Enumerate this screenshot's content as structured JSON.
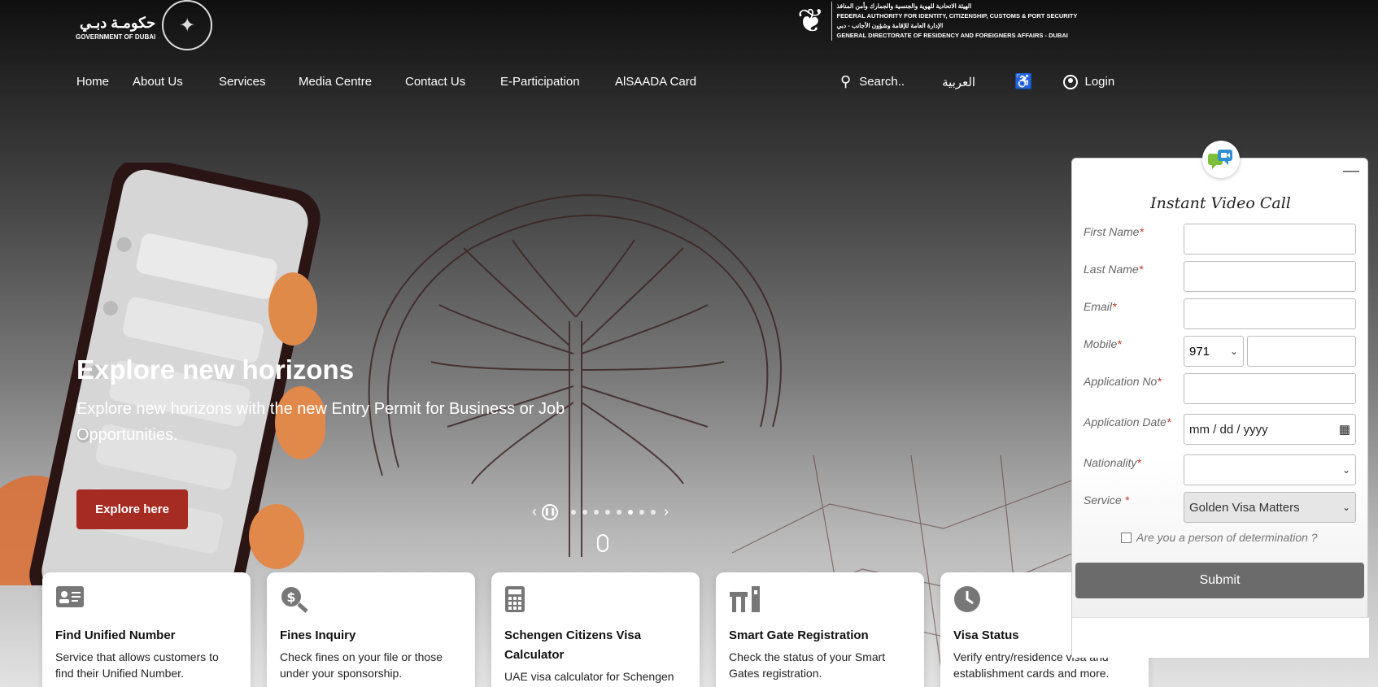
{
  "header": {
    "gov_logo_ar": "حكومـة دبـي",
    "gov_logo_en": "GOVERNMENT OF DUBAI",
    "gdrfa_lines": [
      "الهيئة الاتحادية للهوية والجنسية والجمارك وأمن المنافذ",
      "FEDERAL AUTHORITY FOR IDENTITY, CITIZENSHIP, CUSTOMS & PORT SECURITY",
      "الإدارة العامة للإقامة وشؤون الأجانب - دبي",
      "GENERAL DIRECTORATE OF RESIDENCY AND FOREIGNERS AFFAIRS - DUBAI"
    ]
  },
  "nav": {
    "items": [
      "Home",
      "About Us",
      "Services",
      "Media Centre",
      "Contact Us",
      "E-Participation",
      "AlSAADA Card"
    ],
    "search_label": "Search..",
    "language": "العربية",
    "login": "Login"
  },
  "hero": {
    "title": "Explore new horizons",
    "subtitle": "Explore new horizons with the new Entry Permit for Business or Job Opportunities.",
    "cta": "Explore here",
    "slide_count": 8,
    "active_slide": 6
  },
  "cards": [
    {
      "icon": "id-card-icon",
      "title": "Find Unified Number",
      "desc": "Service that allows customers to find their Unified Number."
    },
    {
      "icon": "dollar-search-icon",
      "title": "Fines Inquiry",
      "desc": "Check fines on your file or those under your sponsorship."
    },
    {
      "icon": "calculator-icon",
      "title": "Schengen Citizens Visa Calculator",
      "desc": "UAE visa calculator for Schengen citizens"
    },
    {
      "icon": "smart-gate-icon",
      "title": "Smart Gate Registration",
      "desc": "Check the status of your Smart Gates registration."
    },
    {
      "icon": "clock-icon",
      "title": "Visa Status",
      "desc": "Verify entry/residence visa and establishment cards and more."
    }
  ],
  "video_call": {
    "title": "Instant Video Call",
    "minimize": "—",
    "fields": {
      "first_name": "First Name",
      "last_name": "Last Name",
      "email": "Email",
      "mobile": "Mobile",
      "country_code": "971",
      "app_no": "Application No",
      "app_date": "Application Date",
      "date_placeholder": "mm / dd / yyyy",
      "nationality": "Nationality",
      "service": "Service ",
      "service_value": "Golden Visa Matters"
    },
    "required_mark": "*",
    "determination": "Are you a person of determination ?",
    "submit": "Submit"
  },
  "colors": {
    "accent_red": "#a62b22",
    "submit_grey": "#6b6b6b"
  }
}
